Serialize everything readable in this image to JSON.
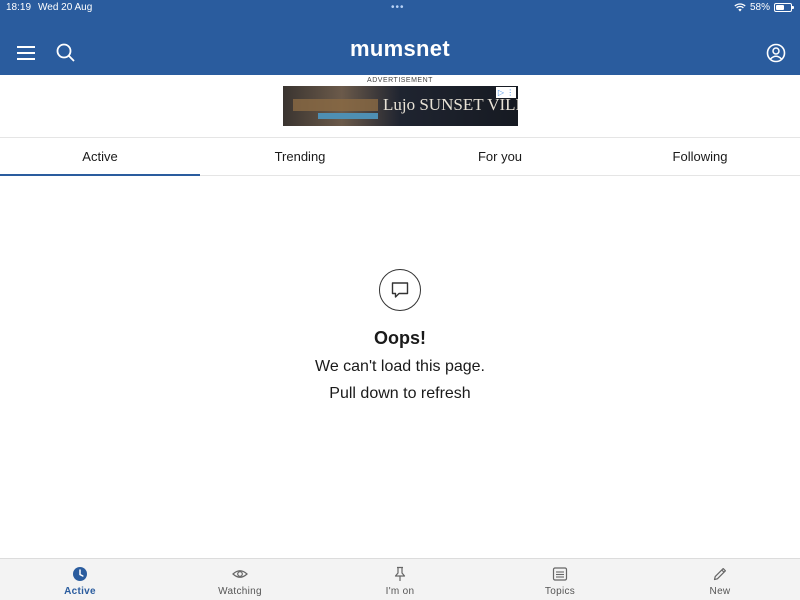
{
  "status_bar": {
    "time": "18:19",
    "date": "Wed 20 Aug",
    "battery_percent": "58%",
    "battery_level": 0.58
  },
  "header": {
    "brand": "mumsnet",
    "icons": [
      "menu-icon",
      "search-icon",
      "profile-icon"
    ]
  },
  "advertisement": {
    "label": "ADVERTISEMENT",
    "banner_text": "Lujo SUNSET VILLAS"
  },
  "tabs": [
    {
      "label": "Active",
      "active": true
    },
    {
      "label": "Trending",
      "active": false
    },
    {
      "label": "For you",
      "active": false
    },
    {
      "label": "Following",
      "active": false
    }
  ],
  "error": {
    "icon": "speech-bubble-icon",
    "title": "Oops!",
    "message": "We can't load this page.",
    "hint": "Pull down to refresh"
  },
  "bottom_nav": [
    {
      "label": "Active",
      "icon": "clock-icon",
      "active": true
    },
    {
      "label": "Watching",
      "icon": "eye-icon",
      "active": false
    },
    {
      "label": "I'm on",
      "icon": "pin-icon",
      "active": false
    },
    {
      "label": "Topics",
      "icon": "topics-icon",
      "active": false
    },
    {
      "label": "New",
      "icon": "pencil-icon",
      "active": false
    }
  ],
  "colors": {
    "brand_blue": "#2a5c9e",
    "background": "#ffffff",
    "nav_background": "#f3f3f3"
  }
}
